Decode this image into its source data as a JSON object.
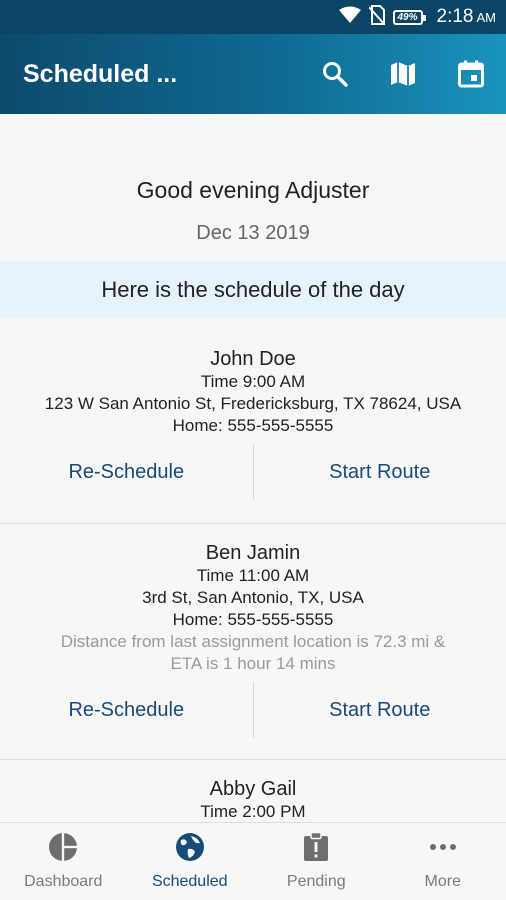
{
  "status_bar": {
    "battery": "49",
    "time": "2:18",
    "ampm": "AM"
  },
  "appbar": {
    "title": "Scheduled ...",
    "actions": [
      "search-icon",
      "map-icon",
      "calendar-icon"
    ]
  },
  "main": {
    "greeting": "Good evening Adjuster",
    "date": "Dec 13 2019",
    "banner": "Here is the schedule of the day",
    "reschedule_label": "Re-Schedule",
    "start_route_label": "Start Route",
    "appointments": [
      {
        "name": "John Doe",
        "time": "Time 9:00 AM",
        "address": "123 W San Antonio St, Fredericksburg, TX 78624, USA",
        "phone": "Home: 555-555-5555"
      },
      {
        "name": "Ben Jamin",
        "time": "Time 11:00 AM",
        "address": "3rd St, San Antonio, TX, USA",
        "phone": "Home: 555-555-5555",
        "distance_line1": "Distance from last assignment location is 72.3 mi &",
        "distance_line2": "ETA is 1 hour 14 mins"
      },
      {
        "name": "Abby Gail",
        "time": "Time 2:00 PM"
      }
    ]
  },
  "bottom_nav": [
    {
      "label": "Dashboard",
      "icon": "dashboard-icon"
    },
    {
      "label": "Scheduled",
      "icon": "globe-icon",
      "active": true
    },
    {
      "label": "Pending",
      "icon": "clipboard-alert-icon"
    },
    {
      "label": "More",
      "icon": "more-dots-icon"
    }
  ],
  "colors": {
    "appbar_start": "#0d4a6d",
    "appbar_end": "#1a93bd",
    "accent": "#174a78",
    "banner_bg": "#e6f3fb"
  }
}
